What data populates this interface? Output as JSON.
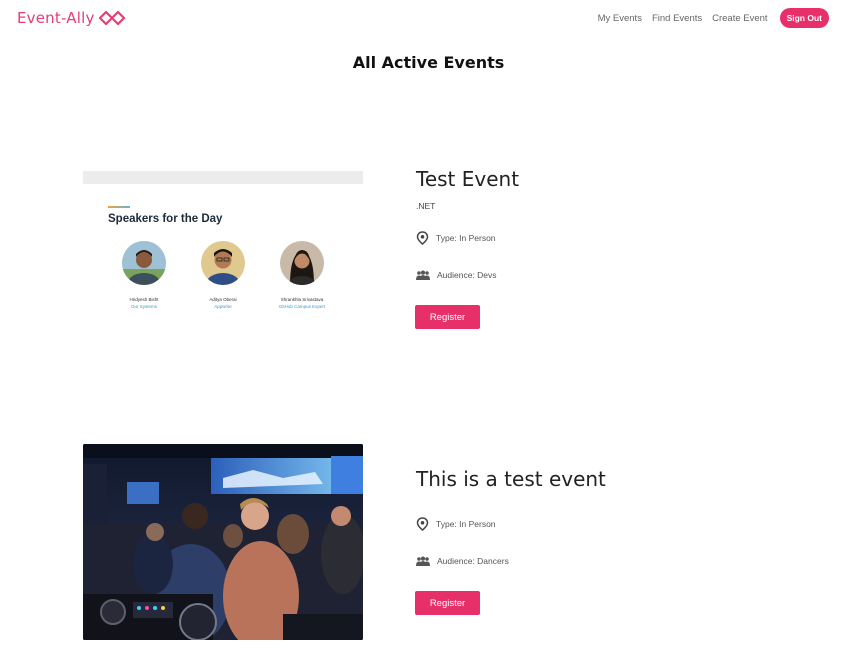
{
  "brand": {
    "name": "Event-Ally",
    "color": "#e73d72"
  },
  "nav": {
    "links": [
      "My Events",
      "Find Events",
      "Create Event"
    ],
    "signout_label": "Sign Out"
  },
  "page": {
    "title": "All Active Events"
  },
  "events": [
    {
      "title": "Test Event",
      "subtitle": ".NET",
      "type": "Type: In Person",
      "audience": "Audience: Devs",
      "register_label": "Register",
      "image": {
        "heading": "Speakers for the Day",
        "speakers": [
          {
            "name": "Hridyesh Bisht",
            "role": "Our Systems"
          },
          {
            "name": "Aditya Oberai",
            "role": "Appwrite"
          },
          {
            "name": "Shrankhla Srivastava",
            "role": "GitHub Campus Expert"
          }
        ]
      }
    },
    {
      "title": "This is a test event",
      "type": "Type: In Person",
      "audience": "Audience: Dancers",
      "register_label": "Register"
    }
  ],
  "colors": {
    "accent": "#e7306a",
    "text": "#222222"
  }
}
